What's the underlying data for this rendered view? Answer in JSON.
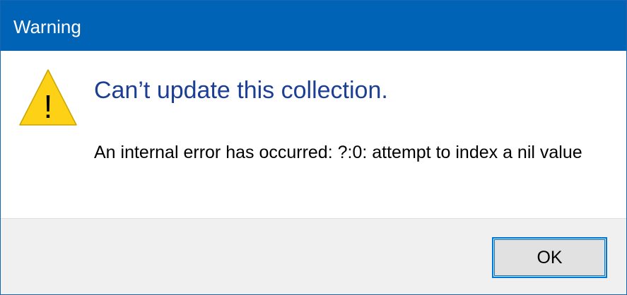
{
  "window": {
    "title": "Warning"
  },
  "content": {
    "icon": "warning-triangle-icon",
    "icon_glyph": "!",
    "icon_color": "#fcd116",
    "heading": "Can’t update this collection.",
    "heading_color": "#1b3f94",
    "message": "An internal error has occurred: ?:0: attempt to index a nil value"
  },
  "footer": {
    "ok_label": "OK",
    "accent_color": "#0078d7"
  },
  "colors": {
    "titlebar": "#0163b5",
    "footer_bg": "#f0f0f0"
  }
}
